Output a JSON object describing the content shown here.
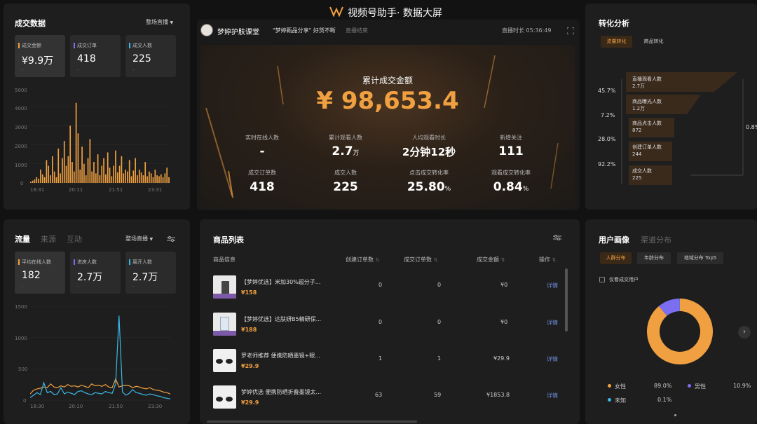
{
  "header": {
    "title": "视频号助手· 数据大屏"
  },
  "sales": {
    "title": "成交数据",
    "filter": "整场直播",
    "cards": [
      {
        "label": "成交金额",
        "value": "¥9.9万",
        "dash": "-",
        "color": "#f0a040"
      },
      {
        "label": "成交订单",
        "value": "418",
        "dash": "-",
        "color": "#7b6ef0"
      },
      {
        "label": "成交人数",
        "value": "225",
        "dash": "-",
        "color": "#3ab8e8"
      }
    ],
    "chart_data": {
      "type": "bar",
      "y_ticks": [
        "5000",
        "4000",
        "3000",
        "2000",
        "1000",
        "0"
      ],
      "x_ticks": [
        "18:31",
        "20:11",
        "21:51",
        "23:31"
      ],
      "ylim": [
        0,
        5000
      ],
      "values": [
        60,
        120,
        180,
        300,
        220,
        700,
        450,
        300,
        1200,
        900,
        400,
        1400,
        600,
        300,
        1800,
        500,
        1300,
        2200,
        900,
        1400,
        3000,
        1100,
        600,
        4200,
        2600,
        700,
        1900,
        1000,
        400,
        1300,
        2300,
        600,
        1100,
        500,
        1500,
        400,
        900,
        1300,
        450,
        1600,
        800,
        350,
        900,
        1700,
        550,
        900,
        1400,
        500,
        700,
        600,
        1200,
        350,
        650,
        1300,
        400,
        700,
        550,
        400,
        1100,
        350,
        600,
        500,
        300,
        700,
        400,
        350,
        450,
        300,
        500,
        800,
        300
      ]
    }
  },
  "live": {
    "host_name": "梦婷护肤课堂",
    "product_pin": "\"梦婷甄品分享\" 好货不断",
    "status": "直播结束",
    "duration": "直播时长 05:36:49",
    "total_label": "累计成交金额",
    "total_value": "¥ 98,653.4",
    "stats": [
      {
        "label": "实时在线人数",
        "value": "-",
        "unit": ""
      },
      {
        "label": "累计观看人数",
        "value": "2.7",
        "unit": "万"
      },
      {
        "label": "人均观看时长",
        "value": "2分钟12秒",
        "unit": ""
      },
      {
        "label": "新增关注",
        "value": "111",
        "unit": ""
      },
      {
        "label": "成交订单数",
        "value": "418",
        "unit": ""
      },
      {
        "label": "成交人数",
        "value": "225",
        "unit": ""
      },
      {
        "label": "点击成交转化率",
        "value": "25.80",
        "unit": "%"
      },
      {
        "label": "观看成交转化率",
        "value": "0.84",
        "unit": "%"
      }
    ]
  },
  "conversion": {
    "title": "转化分析",
    "tabs": [
      "流量转化",
      "商品转化"
    ],
    "pcts": [
      "45.7%",
      "7.2%",
      "28.0%",
      "92.2%"
    ],
    "side_pct": "0.8%",
    "steps": [
      {
        "label": "直播观看人数",
        "value": "2.7万"
      },
      {
        "label": "商品曝光人数",
        "value": "1.2万"
      },
      {
        "label": "商品点击人数",
        "value": "872"
      },
      {
        "label": "创建订单人数",
        "value": "244"
      },
      {
        "label": "成交人数",
        "value": "225"
      }
    ]
  },
  "traffic": {
    "tabs": [
      "流量",
      "来源",
      "互动"
    ],
    "filter": "整场直播",
    "cards": [
      {
        "label": "平均在线人数",
        "value": "182",
        "dash": "-",
        "color": "#f0a040"
      },
      {
        "label": "进房人数",
        "value": "2.7万",
        "dash": "-",
        "color": "#7b6ef0"
      },
      {
        "label": "离开人数",
        "value": "2.7万",
        "dash": "-",
        "color": "#3ab8e8"
      }
    ],
    "chart_data": {
      "type": "line",
      "y_ticks": [
        "1500",
        "1000",
        "500",
        "0"
      ],
      "x_ticks": [
        "18:30",
        "20:10",
        "21:50",
        "23:30"
      ],
      "ylim": [
        0,
        1500
      ],
      "series": [
        {
          "color": "#f0a040",
          "values": [
            100,
            160,
            180,
            190,
            210,
            200,
            260,
            210,
            200,
            230,
            210,
            250,
            220,
            230,
            210,
            240,
            220,
            200,
            260,
            230,
            240,
            220,
            250,
            210,
            200,
            340,
            210,
            230,
            240,
            230,
            200,
            220,
            210,
            190,
            180,
            200,
            170,
            160,
            150,
            130,
            120,
            100
          ]
        },
        {
          "color": "#3ab8e8",
          "values": [
            40,
            80,
            120,
            90,
            280,
            120,
            140,
            90,
            100,
            200,
            100,
            130,
            110,
            90,
            140,
            150,
            120,
            100,
            90,
            120,
            110,
            100,
            140,
            120,
            110,
            260,
            1350,
            130,
            80,
            110,
            170,
            120,
            110,
            90,
            80,
            100,
            90,
            70,
            60,
            40,
            30,
            20
          ]
        }
      ]
    }
  },
  "products": {
    "title": "商品列表",
    "headers": [
      "商品信息",
      "创建订单数",
      "成交订单数",
      "成交金额",
      "操作"
    ],
    "rows": [
      {
        "name": "【梦婷优选】米加30%超分子...",
        "price": "¥158",
        "created": "0",
        "paid": "0",
        "amount": "¥0",
        "action": "详情"
      },
      {
        "name": "【梦婷优选】达肤妍B5精研保...",
        "price": "¥188",
        "created": "0",
        "paid": "0",
        "amount": "¥0",
        "action": "详情"
      },
      {
        "name": "罗老师推荐 便携防晒墨镜+眼...",
        "price": "¥29.9",
        "created": "1",
        "paid": "1",
        "amount": "¥29.9",
        "action": "详情"
      },
      {
        "name": "梦婷优选 便携防晒折叠墨镜太...",
        "price": "¥29.9",
        "created": "63",
        "paid": "59",
        "amount": "¥1853.8",
        "action": "详情"
      }
    ]
  },
  "audience": {
    "tabs": [
      "用户画像",
      "渠道分布"
    ],
    "chips": [
      "人群分布",
      "年龄分布",
      "地域分布 Top5"
    ],
    "checkbox_label": "仅看成交用户",
    "legend": [
      {
        "label": "女性",
        "value": "89.0%",
        "color": "#f0a040"
      },
      {
        "label": "男性",
        "value": "10.9%",
        "color": "#7b6ef0"
      },
      {
        "label": "未知",
        "value": "0.1%",
        "color": "#3ab8e8"
      }
    ],
    "donut": [
      {
        "value": 89.0,
        "color": "#f0a040"
      },
      {
        "value": 10.9,
        "color": "#7b6ef0"
      },
      {
        "value": 0.1,
        "color": "#3ab8e8"
      }
    ]
  }
}
